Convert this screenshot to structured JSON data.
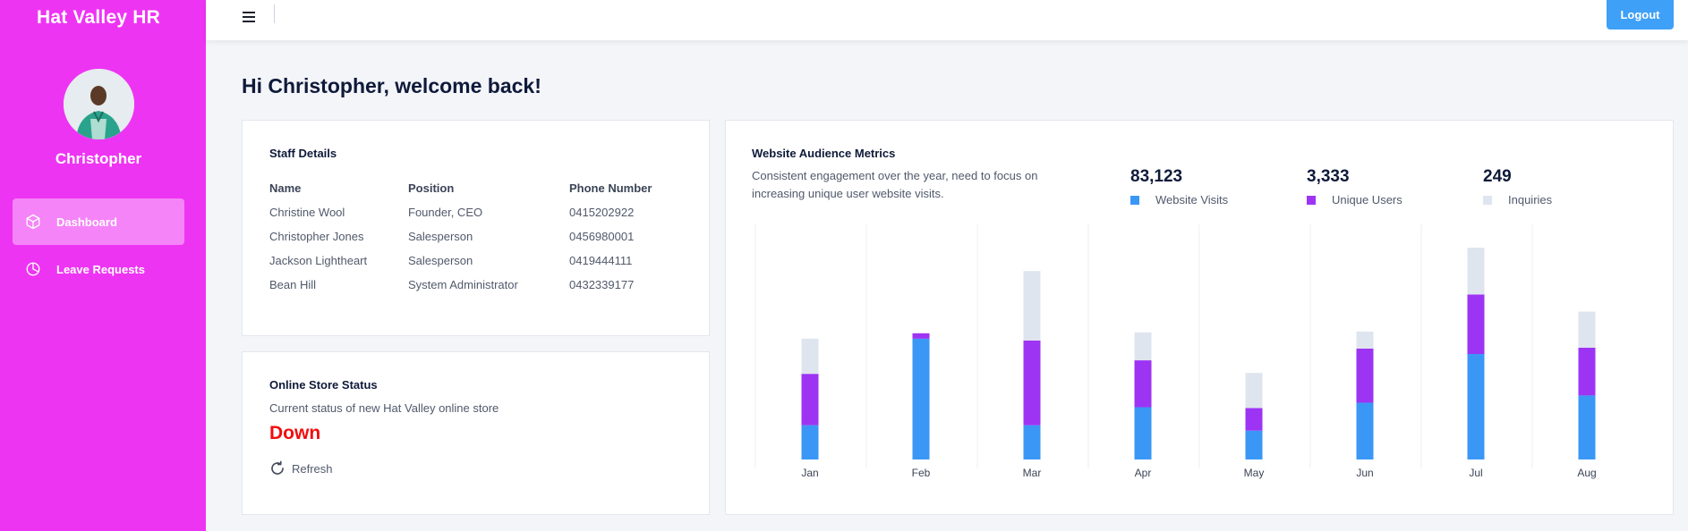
{
  "app": {
    "brand": "Hat Valley HR"
  },
  "user": {
    "name": "Christopher"
  },
  "sidebar": {
    "items": [
      {
        "label": "Dashboard",
        "icon": "cube-icon",
        "active": true
      },
      {
        "label": "Leave Requests",
        "icon": "pie-chart-icon",
        "active": false
      }
    ]
  },
  "header": {
    "logout_label": "Logout",
    "menu_icon": "hamburger-icon"
  },
  "greeting": "Hi Christopher, welcome back!",
  "staff": {
    "title": "Staff Details",
    "columns": [
      "Name",
      "Position",
      "Phone Number"
    ],
    "rows": [
      [
        "Christine Wool",
        "Founder, CEO",
        "0415202922"
      ],
      [
        "Christopher Jones",
        "Salesperson",
        "0456980001"
      ],
      [
        "Jackson Lightheart",
        "Salesperson",
        "0419444111"
      ],
      [
        "Bean Hill",
        "System Administrator",
        "0432339177"
      ]
    ]
  },
  "store": {
    "title": "Online Store Status",
    "subtitle": "Current status of new Hat Valley online store",
    "status": "Down",
    "status_color": "#f20d0d",
    "refresh_label": "Refresh",
    "refresh_icon": "refresh-icon"
  },
  "metrics": {
    "title": "Website Audience Metrics",
    "description": "Consistent engagement over the year, need to focus on increasing unique user website visits.",
    "stats": [
      {
        "value": "83,123",
        "label": "Website Visits",
        "color": "#3a97f6"
      },
      {
        "value": "3,333",
        "label": "Unique Users",
        "color": "#9d34f3"
      },
      {
        "value": "249",
        "label": "Inquiries",
        "color": "#dfe5ee"
      }
    ]
  },
  "chart_data": {
    "type": "bar",
    "stacked": true,
    "categories": [
      "Jan",
      "Feb",
      "Mar",
      "Apr",
      "May",
      "Jun",
      "Jul",
      "Aug"
    ],
    "series": [
      {
        "name": "Website Visits",
        "color": "#3a97f6",
        "values": [
          38,
          134,
          38,
          58,
          32,
          63,
          117,
          71
        ]
      },
      {
        "name": "Unique Users",
        "color": "#9d34f3",
        "values": [
          57,
          6,
          94,
          52,
          25,
          60,
          66,
          53
        ]
      },
      {
        "name": "Inquiries",
        "color": "#dfe5ee",
        "values": [
          39,
          0,
          77,
          31,
          39,
          19,
          52,
          40
        ]
      }
    ],
    "grid": true,
    "legend": "top-right"
  }
}
